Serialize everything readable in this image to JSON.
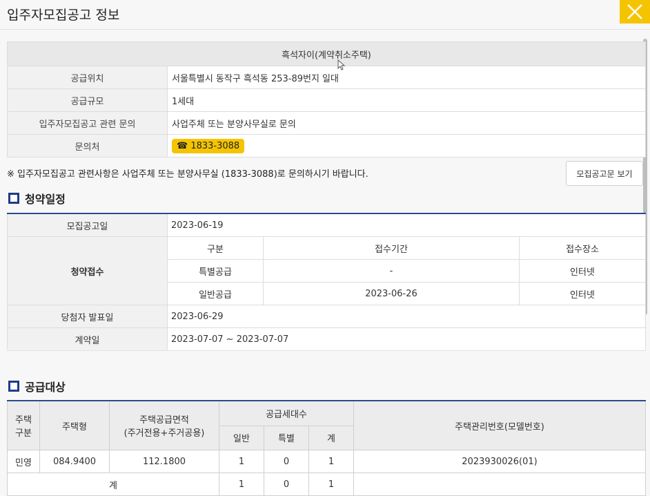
{
  "header": {
    "title": "입주자모집공고 정보"
  },
  "info": {
    "complex_name": "흑석자이(계약취소주택)",
    "rows": [
      {
        "label": "공급위치",
        "value": "서울특별시 동작구 흑석동 253-89번지 일대"
      },
      {
        "label": "공급규모",
        "value": "1세대"
      },
      {
        "label": "입주자모집공고 관련 문의",
        "value": "사업주체 또는 분양사무실로 문의"
      }
    ],
    "contact_label": "문의처",
    "contact_phone": "☎ 1833-3088"
  },
  "notice": "※ 입주자모집공고 관련사항은 사업주체 또는 분양사무실 (1833-3088)로 문의하시기 바랍니다.",
  "doc_button": "모집공고문 보기",
  "schedule": {
    "title": "청약일정",
    "announce_label": "모집공고일",
    "announce_date": "2023-06-19",
    "apply_label": "청약접수",
    "apply_headers": [
      "구분",
      "접수기간",
      "접수장소"
    ],
    "apply_rows": [
      {
        "type": "특별공급",
        "period": "-",
        "place": "인터넷"
      },
      {
        "type": "일반공급",
        "period": "2023-06-26",
        "place": "인터넷"
      }
    ],
    "winner_label": "당첨자 발표일",
    "winner_date": "2023-06-29",
    "contract_label": "계약일",
    "contract_date": "2023-07-07 ~ 2023-07-07"
  },
  "supply": {
    "title": "공급대상",
    "headers": {
      "house_type_cat": "주택\n구분",
      "house_type": "주택형",
      "area": "주택공급면적\n(주거전용+주거공용)",
      "units": "공급세대수",
      "general": "일반",
      "special": "특별",
      "total": "계",
      "model_no": "주택관리번호(모델번호)"
    },
    "rows": [
      {
        "cat": "민영",
        "type": "084.9400",
        "area": "112.1800",
        "general": "1",
        "special": "0",
        "total": "1",
        "model": "2023930026(01)"
      }
    ],
    "total_row": {
      "label": "계",
      "general": "1",
      "special": "0",
      "total": "1"
    }
  },
  "colors": {
    "accent_yellow": "#f5c400",
    "navy": "#1e3a8a"
  }
}
